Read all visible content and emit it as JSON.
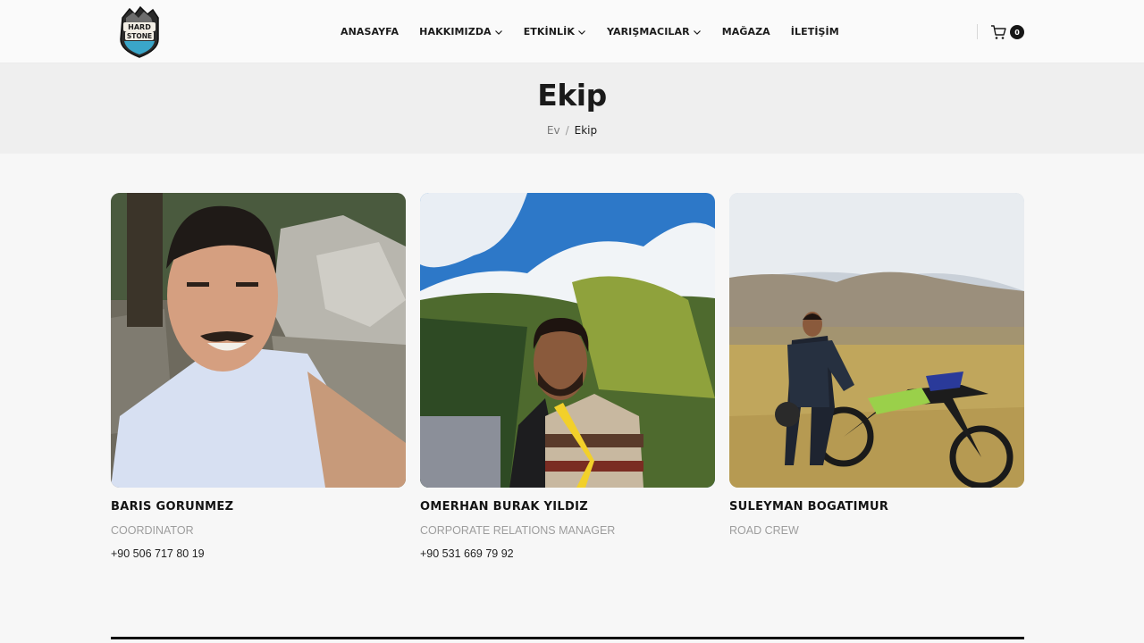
{
  "brand": {
    "logo_text_line1": "HARD",
    "logo_text_line2": "STONE"
  },
  "nav": [
    {
      "label": "ANASAYFA",
      "dropdown": false
    },
    {
      "label": "HAKKIMIZDA",
      "dropdown": true
    },
    {
      "label": "ETKİNLİK",
      "dropdown": true
    },
    {
      "label": "YARIŞMACILAR",
      "dropdown": true
    },
    {
      "label": "MAĞAZA",
      "dropdown": false
    },
    {
      "label": "İLETİŞİM",
      "dropdown": false
    }
  ],
  "cart": {
    "count": "0",
    "icon": "cart-icon"
  },
  "page": {
    "title": "Ekip",
    "breadcrumb": {
      "home": "Ev",
      "separator": "/",
      "current": "Ekip"
    }
  },
  "team": [
    {
      "name": "BARIS GORUNMEZ",
      "role": "COORDINATOR",
      "phone": "+90 506 717 80 19"
    },
    {
      "name": "OMERHAN BURAK YILDIZ",
      "role": "CORPORATE RELATIONS MANAGER",
      "phone": "+90 531 669 79 92"
    },
    {
      "name": "SULEYMAN BOGATIMUR",
      "role": "ROAD CREW",
      "phone": ""
    }
  ],
  "colors": {
    "accent": "#161616",
    "muted": "#9d9d9d",
    "band": "#efefef"
  }
}
